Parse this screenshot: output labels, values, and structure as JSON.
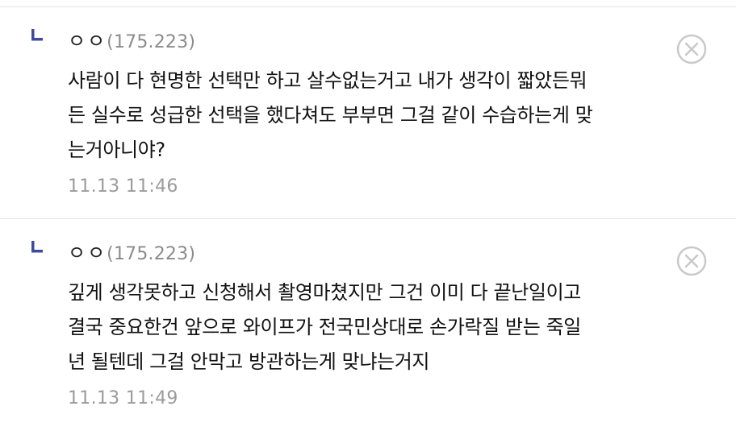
{
  "replies": [
    {
      "nickname": "ㅇㅇ",
      "ip": "(175.223)",
      "body_lines": [
        "사람이 다 현명한 선택만 하고 살수없는거고 내가 생각이 짧았든뭐",
        "든 실수로 성급한 선택을 했다쳐도 부부면 그걸 같이 수습하는게 맞",
        "는거아니야?"
      ],
      "timestamp": "11.13 11:46"
    },
    {
      "nickname": "ㅇㅇ",
      "ip": "(175.223)",
      "body_lines": [
        "깊게 생각못하고 신청해서 촬영마쳤지만 그건 이미 다 끝난일이고",
        "결국 중요한건 앞으로 와이프가 전국민상대로 손가락질 받는 죽일",
        "년 될텐데 그걸 안막고 방관하는게 맞냐는거지"
      ],
      "timestamp": "11.13 11:49"
    }
  ],
  "icons": {
    "reply_marker": "reply-arrow-icon",
    "delete": "close-circle-icon"
  },
  "colors": {
    "reply_marker": "#3d4a9e",
    "divider": "#e4e4ea",
    "meta_text": "#9b9b9b",
    "delete_icon": "#c9c9c9"
  }
}
